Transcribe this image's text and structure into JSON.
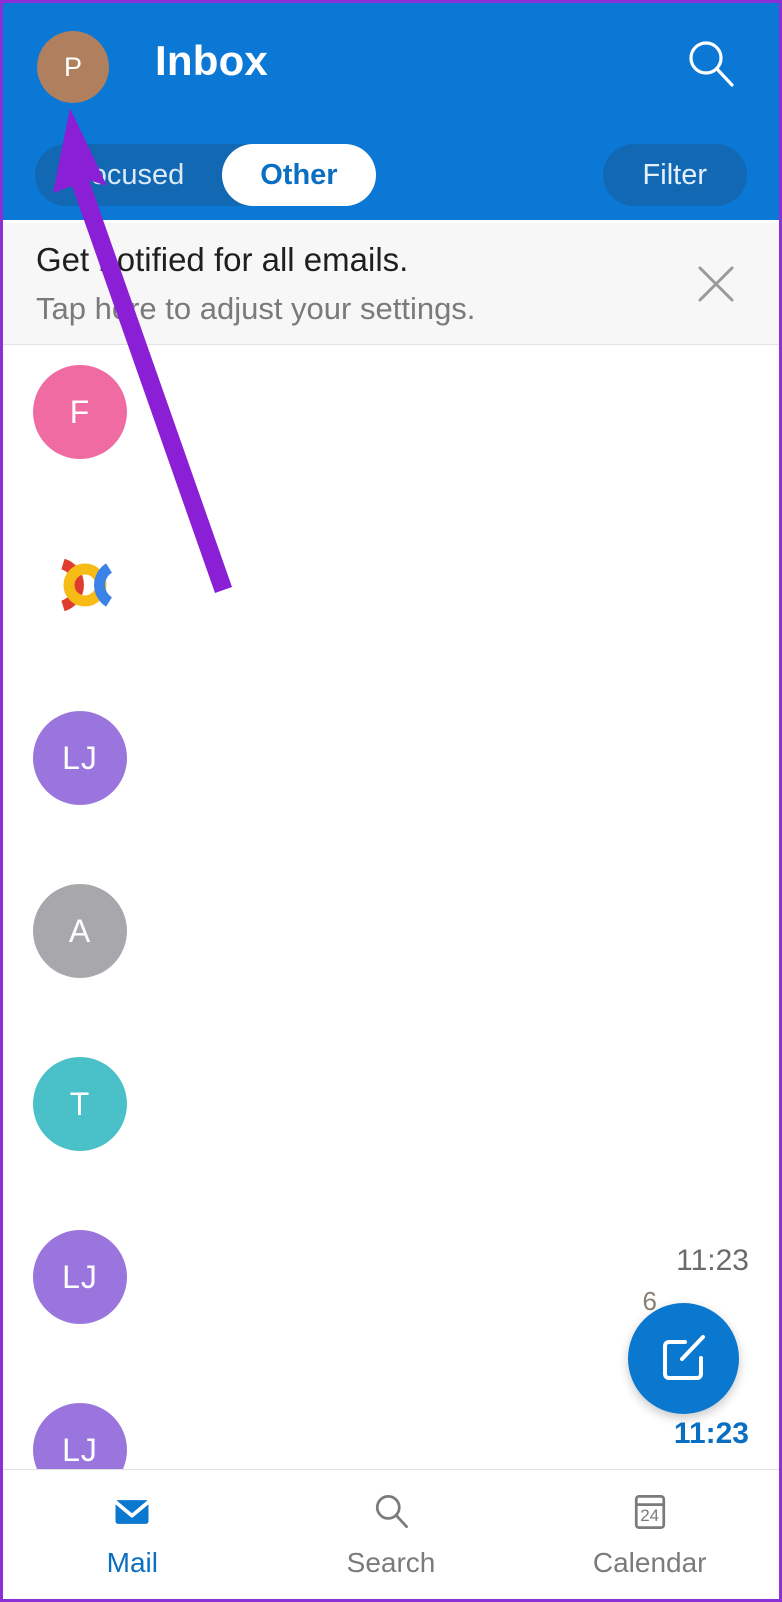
{
  "colors": {
    "header_blue": "#0a78d4",
    "pill_track": "#1268b3",
    "accent_blue": "#0a6fc2",
    "fab_blue": "#0b78d0",
    "arrow_purple": "#8B1FD6",
    "banner_bg": "#f7f7f7"
  },
  "header": {
    "title": "Inbox",
    "avatar_initial": "P",
    "avatar_color": "#b07f5e",
    "search_icon": "search-icon",
    "tabs": [
      {
        "label": "Focused",
        "active": false
      },
      {
        "label": "Other",
        "active": true
      }
    ],
    "filter_label": "Filter"
  },
  "banner": {
    "title": "Get notified for all emails.",
    "subtitle": "Tap here to adjust your settings.",
    "close_icon": "close-icon"
  },
  "mail_rows": [
    {
      "avatar_initial": "F",
      "avatar_color": "#ef6ba2",
      "avatar_type": "initial",
      "time": ""
    },
    {
      "avatar_initial": "",
      "avatar_color": "",
      "avatar_type": "google-logo",
      "time": ""
    },
    {
      "avatar_initial": "LJ",
      "avatar_color": "#9a75dd",
      "avatar_type": "initial",
      "time": ""
    },
    {
      "avatar_initial": "A",
      "avatar_color": "#a8a8ac",
      "avatar_type": "initial",
      "time": ""
    },
    {
      "avatar_initial": "T",
      "avatar_color": "#4ac0c8",
      "avatar_type": "initial",
      "time": ""
    },
    {
      "avatar_initial": "LJ",
      "avatar_color": "#9a75dd",
      "avatar_type": "initial",
      "time": "11:23",
      "unread": false,
      "hidden_char": "6"
    },
    {
      "avatar_initial": "LJ",
      "avatar_color": "#9a75dd",
      "avatar_type": "initial",
      "time": "11:23",
      "unread": true
    }
  ],
  "fab": {
    "icon": "compose-icon"
  },
  "bottom_nav": [
    {
      "label": "Mail",
      "icon": "mail-icon",
      "active": true
    },
    {
      "label": "Search",
      "icon": "search-icon",
      "active": false
    },
    {
      "label": "Calendar",
      "icon": "calendar-icon",
      "day_number": "24",
      "active": false
    }
  ],
  "annotation": {
    "type": "arrow",
    "color": "#8B1FD6",
    "points_to": "profile-avatar"
  }
}
